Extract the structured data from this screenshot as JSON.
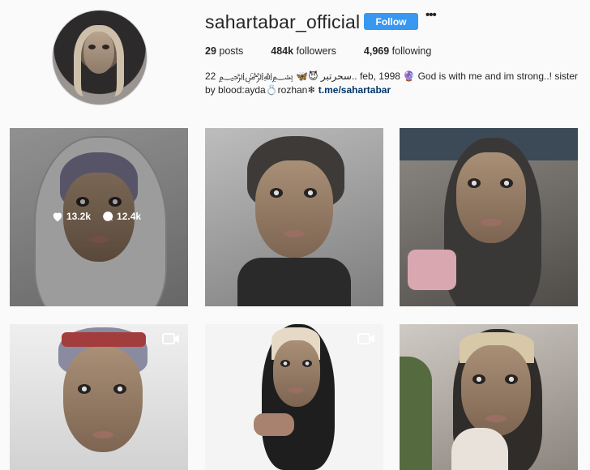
{
  "profile": {
    "username": "sahartabar_official",
    "follow_label": "Follow",
    "more_label": "•••",
    "stats": {
      "posts_value": "29",
      "posts_label": "posts",
      "followers_value": "484k",
      "followers_label": "followers",
      "following_value": "4,969",
      "following_label": "following"
    },
    "bio": {
      "line": "22 ﷽ 🦋😈 سحرتبر.. feb, 1998 🔮 God is with me and im strong..! sister by blood:ayda💍rozhan❄",
      "link": "t.me/sahartabar"
    }
  },
  "posts": [
    {
      "likes": "13.2k",
      "comments": "12.4k",
      "type": "photo",
      "hovered": true
    },
    {
      "type": "photo"
    },
    {
      "type": "photo"
    },
    {
      "type": "video"
    },
    {
      "type": "video"
    },
    {
      "type": "photo"
    }
  ],
  "colors": {
    "follow_button": "#3897f0",
    "link": "#003569",
    "background": "#fafafa"
  }
}
